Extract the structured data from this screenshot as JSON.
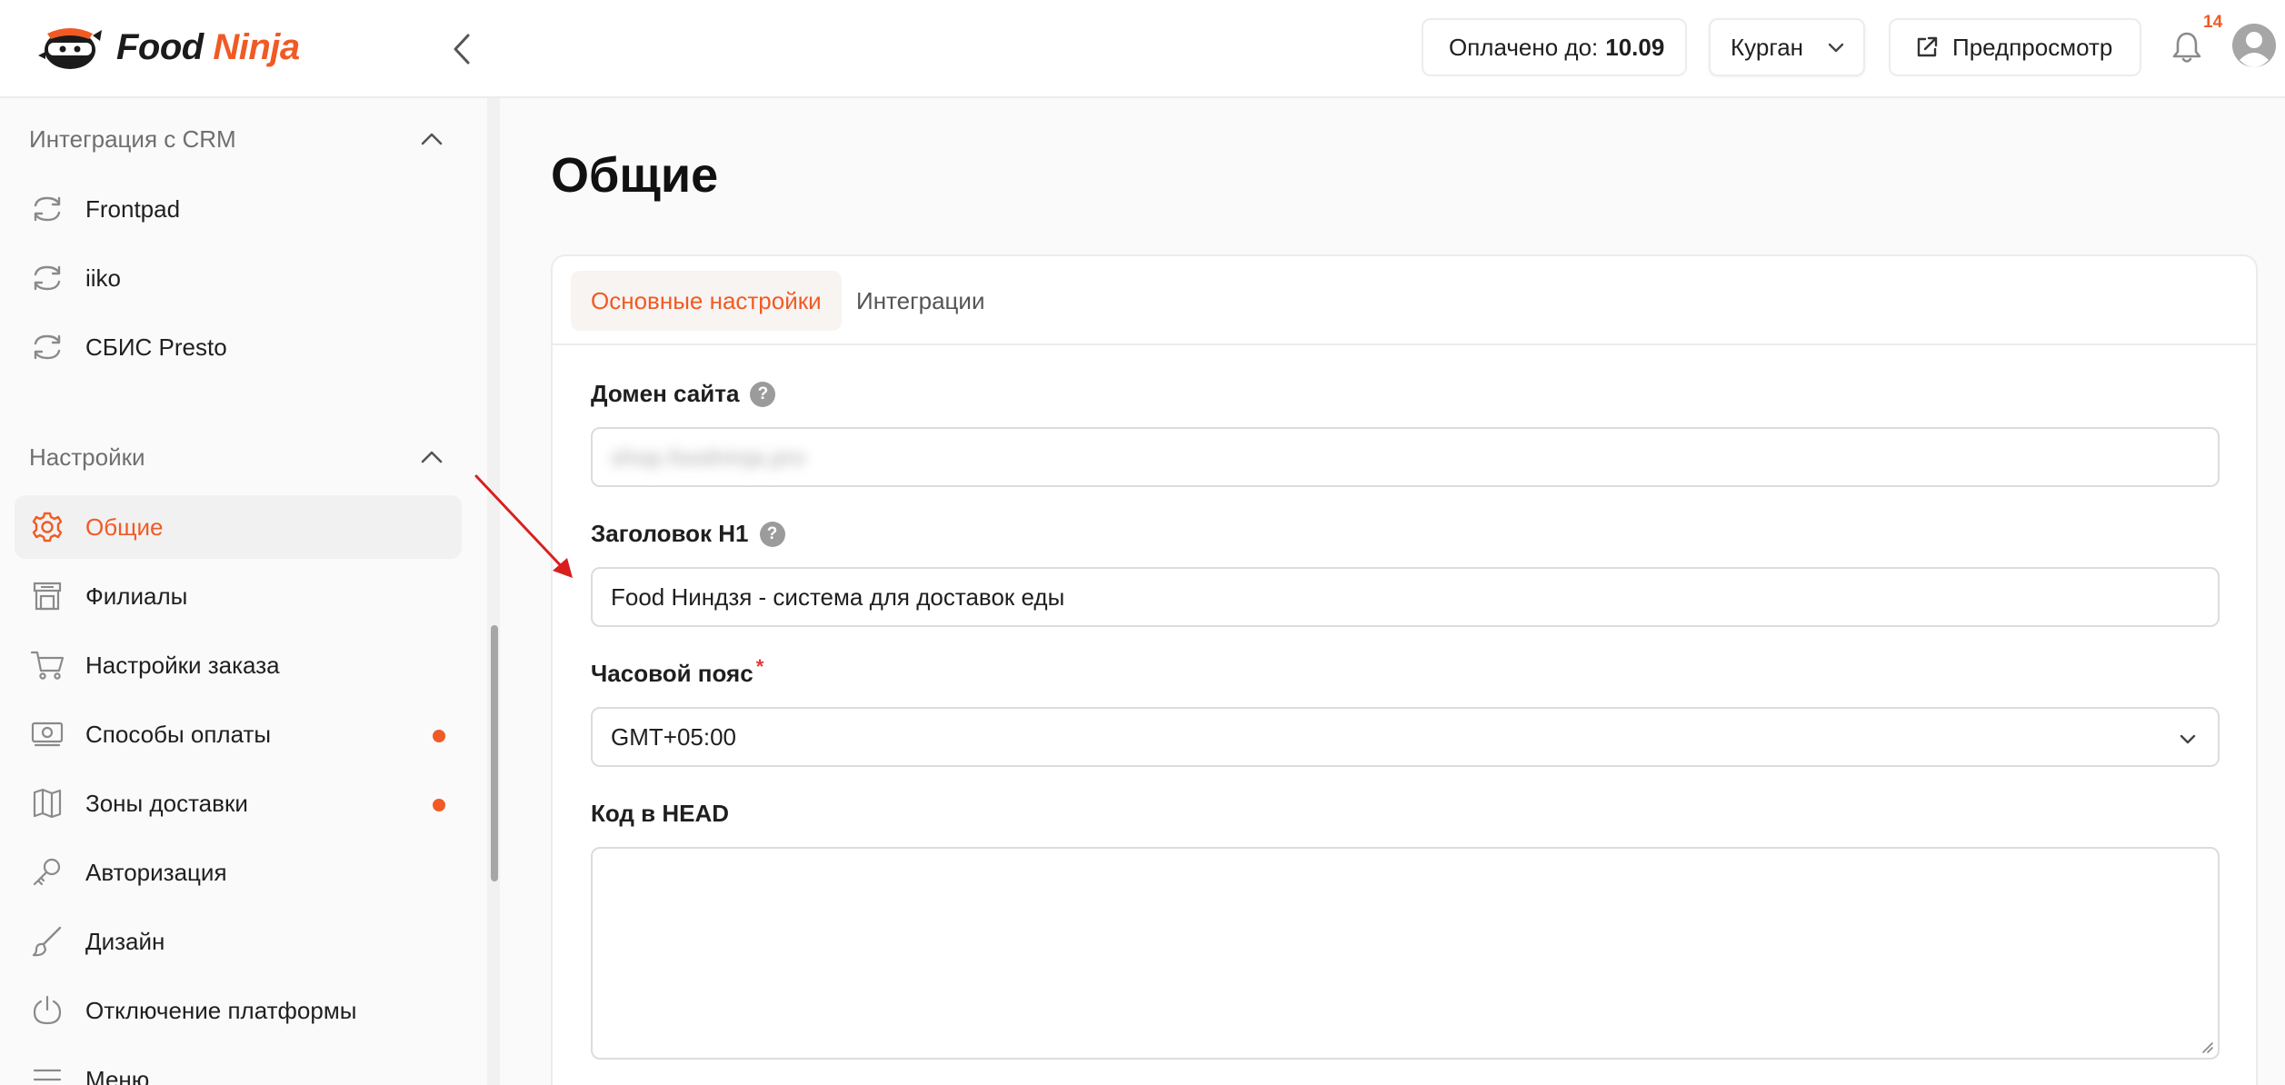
{
  "header": {
    "logo": {
      "word1": "Food",
      "word2": "Ninja"
    },
    "paid_label": "Оплачено до:",
    "paid_value": "10.09",
    "city": "Курган",
    "preview_label": "Предпросмотр",
    "notifications_count": "14"
  },
  "sidebar": {
    "crm_section": {
      "title": "Интеграция с CRM",
      "items": [
        "Frontpad",
        "iiko",
        "СБИС Presto"
      ]
    },
    "settings_section": {
      "title": "Настройки",
      "items": [
        {
          "label": "Общие",
          "icon": "gear-icon",
          "active": true,
          "dot": false
        },
        {
          "label": "Филиалы",
          "icon": "store-icon",
          "active": false,
          "dot": false
        },
        {
          "label": "Настройки заказа",
          "icon": "cart-icon",
          "active": false,
          "dot": false
        },
        {
          "label": "Способы оплаты",
          "icon": "money-icon",
          "active": false,
          "dot": true
        },
        {
          "label": "Зоны доставки",
          "icon": "map-icon",
          "active": false,
          "dot": true
        },
        {
          "label": "Авторизация",
          "icon": "key-icon",
          "active": false,
          "dot": false
        },
        {
          "label": "Дизайн",
          "icon": "brush-icon",
          "active": false,
          "dot": false
        },
        {
          "label": "Отключение платформы",
          "icon": "power-icon",
          "active": false,
          "dot": false
        },
        {
          "label": "Меню",
          "icon": "menu-icon",
          "active": false,
          "dot": false
        }
      ]
    }
  },
  "main": {
    "title": "Общие",
    "tabs": [
      "Основные настройки",
      "Интеграции"
    ],
    "fields": {
      "domain": {
        "label": "Домен сайта",
        "value": "shop.foodninja.pro"
      },
      "h1": {
        "label": "Заголовок H1",
        "value": "Food Ниндзя - система для доставок еды"
      },
      "timezone": {
        "label": "Часовой пояс",
        "required_mark": "*",
        "value": "GMT+05:00"
      },
      "head_code": {
        "label": "Код в HEAD",
        "value": ""
      }
    }
  },
  "colors": {
    "accent": "#f15a24",
    "required": "#e53935"
  }
}
